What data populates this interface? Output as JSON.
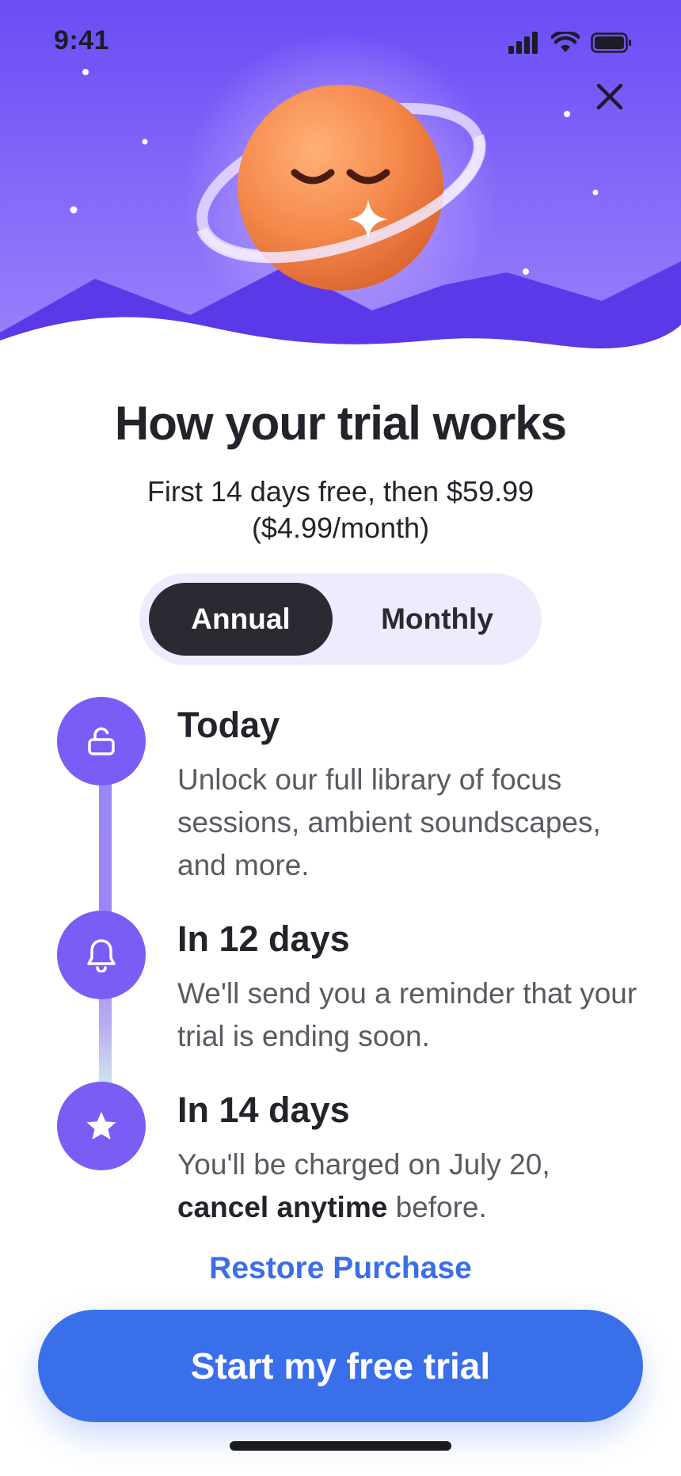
{
  "status_bar": {
    "time": "9:41"
  },
  "header": {
    "title": "How your trial works",
    "subtitle": "First 14 days free, then $59.99 ($4.99/month)"
  },
  "plan_toggle": {
    "options": [
      {
        "label": "Annual",
        "selected": true
      },
      {
        "label": "Monthly",
        "selected": false
      }
    ]
  },
  "timeline": [
    {
      "icon": "unlock-icon",
      "title": "Today",
      "description": "Unlock our full library of focus sessions, ambient soundscapes, and more."
    },
    {
      "icon": "bell-icon",
      "title": "In 12 days",
      "description": "We'll send you a reminder that your trial is ending soon."
    },
    {
      "icon": "star-icon",
      "title": "In 14 days",
      "description_prefix": "You'll be charged on July 20,",
      "description_bold": "cancel anytime",
      "description_suffix": "before."
    }
  ],
  "restore_label": "Restore Purchase",
  "cta_label": "Start my free trial",
  "colors": {
    "hero_top": "#6f4ff4",
    "accent_purple": "#7b5cf4",
    "planet_orange": "#f08a4b",
    "cta_blue": "#3a6fea",
    "link_blue": "#3a6fe6",
    "dark": "#2a2a32"
  }
}
